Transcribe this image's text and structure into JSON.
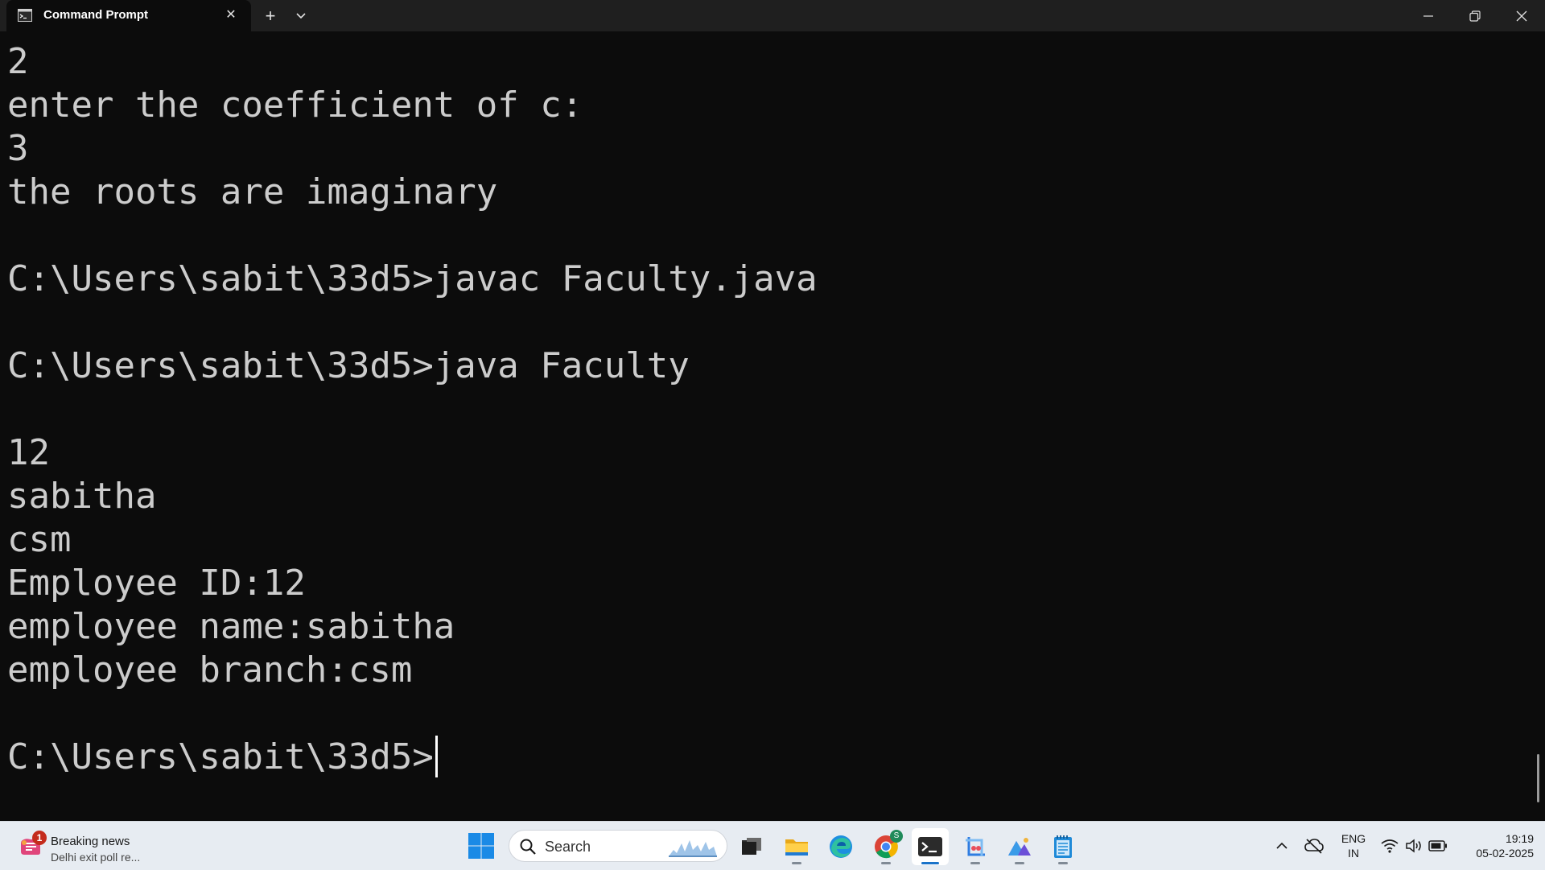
{
  "window": {
    "tab_title": "Command Prompt",
    "tab_close": "✕",
    "new_tab": "+",
    "dropdown": "⌄"
  },
  "terminal": {
    "lines": [
      "2",
      "enter the coefficient of c:",
      "3",
      "the roots are imaginary",
      "",
      "C:\\Users\\sabit\\33d5>javac Faculty.java",
      "",
      "C:\\Users\\sabit\\33d5>java Faculty",
      "",
      "12",
      "sabitha",
      "csm",
      "Employee ID:12",
      "employee name:sabitha",
      "employee branch:csm",
      "",
      "C:\\Users\\sabit\\33d5>"
    ]
  },
  "taskbar": {
    "news_badge": "1",
    "news_title": "Breaking news",
    "news_subtitle": "Delhi exit poll re...",
    "search_placeholder": "Search",
    "chrome_badge": "S",
    "apps": [
      {
        "name": "task-view-icon",
        "active": false,
        "running": false
      },
      {
        "name": "file-explorer-icon",
        "active": false,
        "running": true
      },
      {
        "name": "edge-icon",
        "active": false,
        "running": false
      },
      {
        "name": "chrome-icon",
        "active": false,
        "running": true
      },
      {
        "name": "terminal-icon",
        "active": true,
        "running": true
      },
      {
        "name": "snipping-tool-icon",
        "active": false,
        "running": true
      },
      {
        "name": "photos-icon",
        "active": false,
        "running": true
      },
      {
        "name": "notepad-icon",
        "active": false,
        "running": true
      }
    ],
    "lang_line1": "ENG",
    "lang_line2": "IN",
    "time": "19:19",
    "date": "05-02-2025"
  },
  "colors": {
    "terminal_bg": "#0c0c0c",
    "terminal_fg": "#cccccc",
    "titlebar_bg": "#1f1f1f",
    "taskbar_bg": "#e7ecf2",
    "accent": "#1a73c9"
  }
}
